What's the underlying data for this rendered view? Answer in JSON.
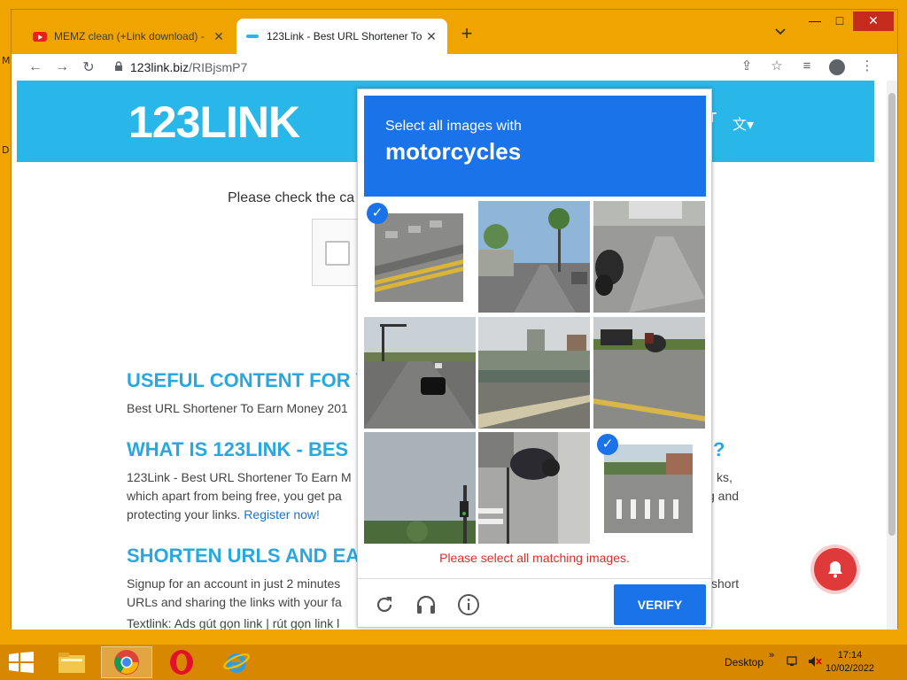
{
  "desktop": {
    "label_top": "M",
    "label_mid": "D"
  },
  "tabs": [
    {
      "title": "MEMZ clean (+Link download) -",
      "close": "✕"
    },
    {
      "title": "123Link - Best URL Shortener To",
      "close": "✕"
    }
  ],
  "newtab": "+",
  "window_controls": {
    "minimize": "—",
    "maximize": "□",
    "close": "✕"
  },
  "toolbar": {
    "url_host": "123link.biz",
    "url_path": "/RIBjsmP7"
  },
  "site": {
    "logo": "123LINK",
    "header_right": "T",
    "captcha_prompt": "Please check the ca",
    "sections": [
      {
        "heading": "USEFUL CONTENT FOR Y",
        "text": "Best URL Shortener To Earn Money 201"
      },
      {
        "heading": "WHAT IS 123LINK - BES",
        "heading_tail": "?",
        "line1": "123Link - Best URL Shortener To Earn M",
        "line1_tail": "ks,",
        "line2": "which apart from being free, you get pa",
        "line2_tail": "g and",
        "line3": "protecting your links. ",
        "link": "Register now!"
      },
      {
        "heading": "SHORTEN URLS AND EA",
        "line1": "Signup for an account in just 2 minutes",
        "line1_tail": "short",
        "line2": "URLs and sharing the links with your fa",
        "line3": "Textlink: Ads gút gọn link | rút gọn link l"
      }
    ]
  },
  "recaptcha": {
    "instruction": "Select all images with",
    "target": "motorcycles",
    "tiles": [
      {
        "selected": true
      },
      {
        "selected": false
      },
      {
        "selected": false
      },
      {
        "selected": false
      },
      {
        "selected": false
      },
      {
        "selected": false
      },
      {
        "selected": false
      },
      {
        "selected": false
      },
      {
        "selected": true
      }
    ],
    "error": "Please select all matching images.",
    "verify_label": "VERIFY"
  },
  "taskbar": {
    "desktop_label": "Desktop",
    "time": "17:14",
    "date": "10/02/2022"
  }
}
